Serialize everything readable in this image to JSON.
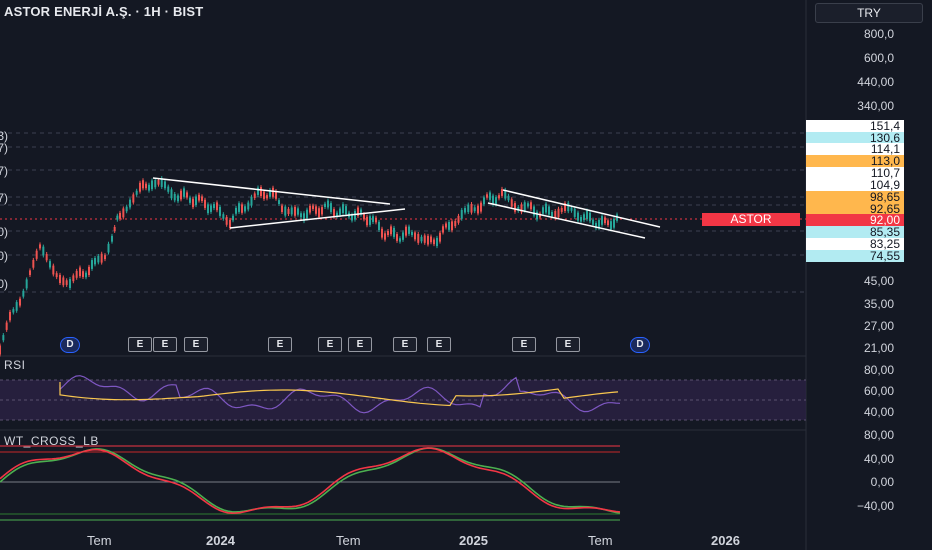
{
  "header": {
    "title": "ASTOR ENERJİ A.Ş. · 1H · BIST",
    "currency": "TRY"
  },
  "price_axis": [
    "800,0",
    "600,0",
    "440,00",
    "340,00",
    "45,00",
    "35,00",
    "27,00",
    "21,00"
  ],
  "left_clipped_labels": [
    "3)",
    "7)",
    "7)",
    "7)",
    "0)",
    "0)",
    "0)"
  ],
  "price_tags": [
    {
      "text": "151,4",
      "style": "white"
    },
    {
      "text": "130,6",
      "style": "cyan"
    },
    {
      "text": "114,1",
      "style": "white"
    },
    {
      "text": "113,0",
      "style": "orange"
    },
    {
      "text": "110,7",
      "style": "white"
    },
    {
      "text": "104,9",
      "style": "white"
    },
    {
      "text": "98,65",
      "style": "orange"
    },
    {
      "text": "92,65",
      "style": "orange"
    },
    {
      "text": "92,00",
      "style": "red"
    },
    {
      "text": "85,35",
      "style": "cyan"
    },
    {
      "text": "83,25",
      "style": "white"
    },
    {
      "text": "74,55",
      "style": "cyan"
    }
  ],
  "symbol_badge": "ASTOR",
  "rsi": {
    "label": "RSI",
    "axis": [
      "80,00",
      "60,00",
      "40,00"
    ]
  },
  "wt": {
    "label": "WT_CROSS_LB",
    "axis": [
      "80,00",
      "40,00",
      "0,00",
      "−40,00"
    ]
  },
  "time_axis": [
    {
      "text": "Tem",
      "bold": false
    },
    {
      "text": "2024",
      "bold": true
    },
    {
      "text": "Tem",
      "bold": false
    },
    {
      "text": "2025",
      "bold": true
    },
    {
      "text": "Tem",
      "bold": false
    },
    {
      "text": "2026",
      "bold": true
    }
  ],
  "events": [
    {
      "text": "D",
      "kind": "dividend"
    },
    {
      "text": "E",
      "kind": "earnings"
    },
    {
      "text": "E",
      "kind": "earnings"
    },
    {
      "text": "E",
      "kind": "earnings"
    },
    {
      "text": "E",
      "kind": "earnings"
    },
    {
      "text": "E",
      "kind": "earnings"
    },
    {
      "text": "E",
      "kind": "earnings"
    },
    {
      "text": "E",
      "kind": "earnings"
    },
    {
      "text": "E",
      "kind": "earnings"
    },
    {
      "text": "D",
      "kind": "dividend"
    }
  ],
  "colors": {
    "up": "#26a69a",
    "down": "#ef5350",
    "rsi": "#7e57c2",
    "rsi_ma": "#f9c74f",
    "wt1": "#4caf50",
    "wt2": "#f23645",
    "trend": "#ffffff",
    "bg": "#141823"
  }
}
